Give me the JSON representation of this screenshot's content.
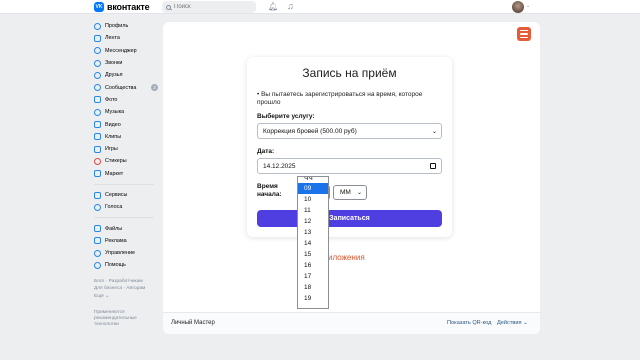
{
  "header": {
    "logo_mark": "VK",
    "logo_text": "вконтакте",
    "search_placeholder": "Поиск"
  },
  "sidebar": {
    "items": [
      {
        "label": "Профиль"
      },
      {
        "label": "Лента"
      },
      {
        "label": "Мессенджер"
      },
      {
        "label": "Звонки"
      },
      {
        "label": "Друзья"
      },
      {
        "label": "Сообщества",
        "badge": "2"
      },
      {
        "label": "Фото"
      },
      {
        "label": "Музыка"
      },
      {
        "label": "Видео"
      },
      {
        "label": "Клипы"
      },
      {
        "label": "Игры"
      },
      {
        "label": "Стикеры"
      },
      {
        "label": "Маркет"
      }
    ],
    "items2": [
      {
        "label": "Сервисы"
      },
      {
        "label": "Голоса"
      }
    ],
    "items3": [
      {
        "label": "Файлы"
      },
      {
        "label": "Реклама"
      },
      {
        "label": "Управление"
      },
      {
        "label": "Помощь"
      }
    ],
    "footer_links": [
      "Блог",
      "Разработчикам",
      "Для бизнеса",
      "Авторам",
      "Ещё"
    ],
    "ads_note": "Применяются рекомендательные технологии"
  },
  "form": {
    "title": "Запись на приём",
    "notice": "Вы пытаетесь зарегистрироваться на время, которое прошло",
    "service_label": "Выберите услугу:",
    "service_value": "Коррекция бровей (500.00 руб)",
    "date_label": "Дата:",
    "date_value": "14.12.2025",
    "time_label": "Время начала:",
    "minutes_value": "ММ",
    "submit_label": "Записаться"
  },
  "settings_link": "ойка приложения",
  "dropdown": {
    "partial_top": "ЧЧ",
    "options": [
      "09",
      "10",
      "11",
      "12",
      "13",
      "14",
      "15",
      "16",
      "17",
      "18",
      "19"
    ],
    "selected": "09"
  },
  "footer": {
    "app_name": "Личный Мастер",
    "qr_link": "Показать QR-код",
    "actions": "Действия"
  },
  "colors": {
    "accent_vk": "#0077ff",
    "submit": "#4f3ee0",
    "menu": "#e65c3b",
    "link_orange": "#d8552e"
  }
}
